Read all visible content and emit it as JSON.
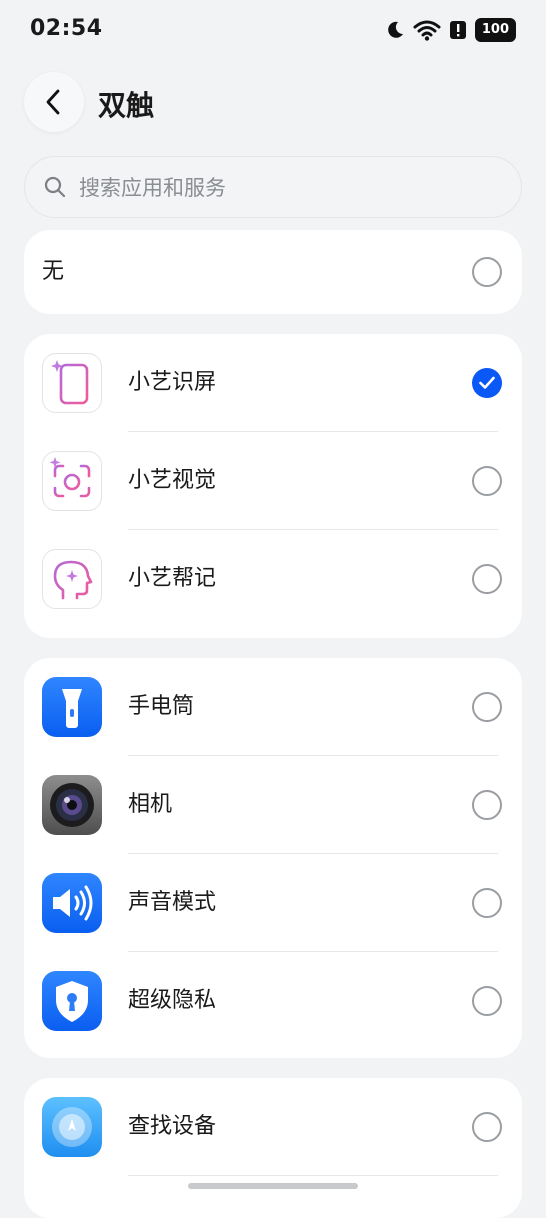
{
  "status_bar": {
    "time": "02:54",
    "battery": "100"
  },
  "header": {
    "title": "双触"
  },
  "search": {
    "placeholder": "搜索应用和服务"
  },
  "none_option": {
    "label": "无",
    "selected": false
  },
  "ai_group": [
    {
      "label": "小艺识屏",
      "icon": "xiaoyi-screen-icon",
      "selected": true
    },
    {
      "label": "小艺视觉",
      "icon": "xiaoyi-vision-icon",
      "selected": false
    },
    {
      "label": "小艺帮记",
      "icon": "xiaoyi-memo-icon",
      "selected": false
    }
  ],
  "tools_group": [
    {
      "label": "手电筒",
      "icon": "flashlight-icon",
      "selected": false
    },
    {
      "label": "相机",
      "icon": "camera-icon",
      "selected": false
    },
    {
      "label": "声音模式",
      "icon": "sound-mode-icon",
      "selected": false
    },
    {
      "label": "超级隐私",
      "icon": "privacy-shield-icon",
      "selected": false
    }
  ],
  "services_group": [
    {
      "label": "查找设备",
      "icon": "find-device-icon",
      "selected": false
    }
  ],
  "colors": {
    "accent": "#0a59f7",
    "ai_gradient_start": "#b46ad8",
    "ai_gradient_end": "#f05a9a"
  }
}
